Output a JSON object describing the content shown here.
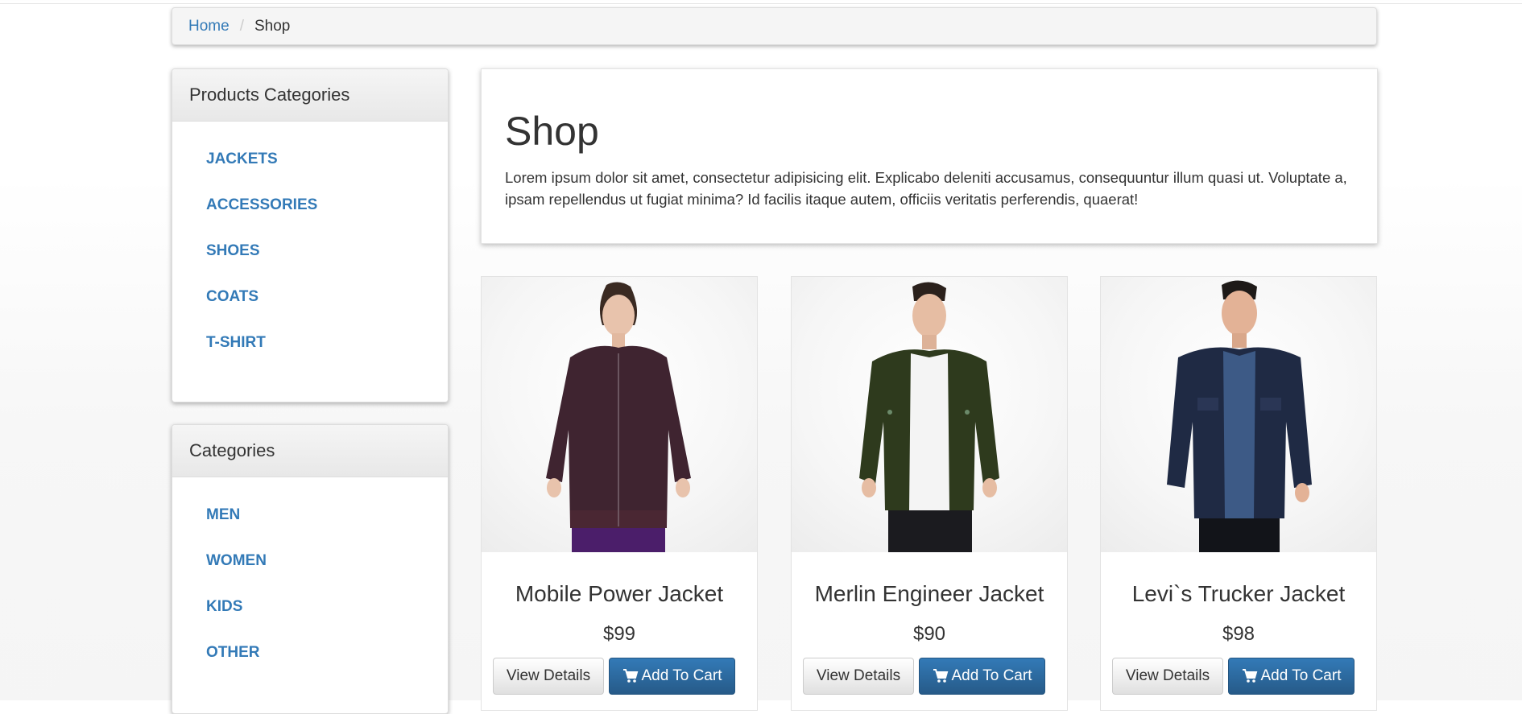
{
  "breadcrumb": {
    "home": "Home",
    "separator": "/",
    "current": "Shop"
  },
  "sidebar": {
    "product_categories": {
      "title": "Products Categories",
      "items": [
        "JACKETS",
        "ACCESSORIES",
        "SHOES",
        "COATS",
        "T-SHIRT"
      ]
    },
    "categories": {
      "title": "Categories",
      "items": [
        "MEN",
        "WOMEN",
        "KIDS",
        "OTHER"
      ]
    }
  },
  "jumbotron": {
    "title": "Shop",
    "text": "Lorem ipsum dolor sit amet, consectetur adipisicing elit. Explicabo deleniti accusamus, consequuntur illum quasi ut. Voluptate a, ipsam repellendus ut fugiat minima? Id facilis itaque autem, officiis veritatis perferendis, quaerat!"
  },
  "products": [
    {
      "name": "Mobile Power Jacket",
      "price": "$99",
      "view_label": "View Details",
      "cart_label": "Add To Cart",
      "image_icon": "woman-jacket-photo"
    },
    {
      "name": "Merlin Engineer Jacket",
      "price": "$90",
      "view_label": "View Details",
      "cart_label": "Add To Cart",
      "image_icon": "man-green-jacket-photo"
    },
    {
      "name": "Levi`s Trucker Jacket",
      "price": "$98",
      "view_label": "View Details",
      "cart_label": "Add To Cart",
      "image_icon": "man-denim-jacket-photo"
    }
  ],
  "colors": {
    "link": "#337ab7",
    "primary": "#2d6ca2",
    "jacket_1": "#3f2430",
    "jacket_2": "#2e3a1d",
    "jacket_3": "#1f2a44"
  },
  "icons": {
    "cart": "shopping-cart-icon"
  }
}
